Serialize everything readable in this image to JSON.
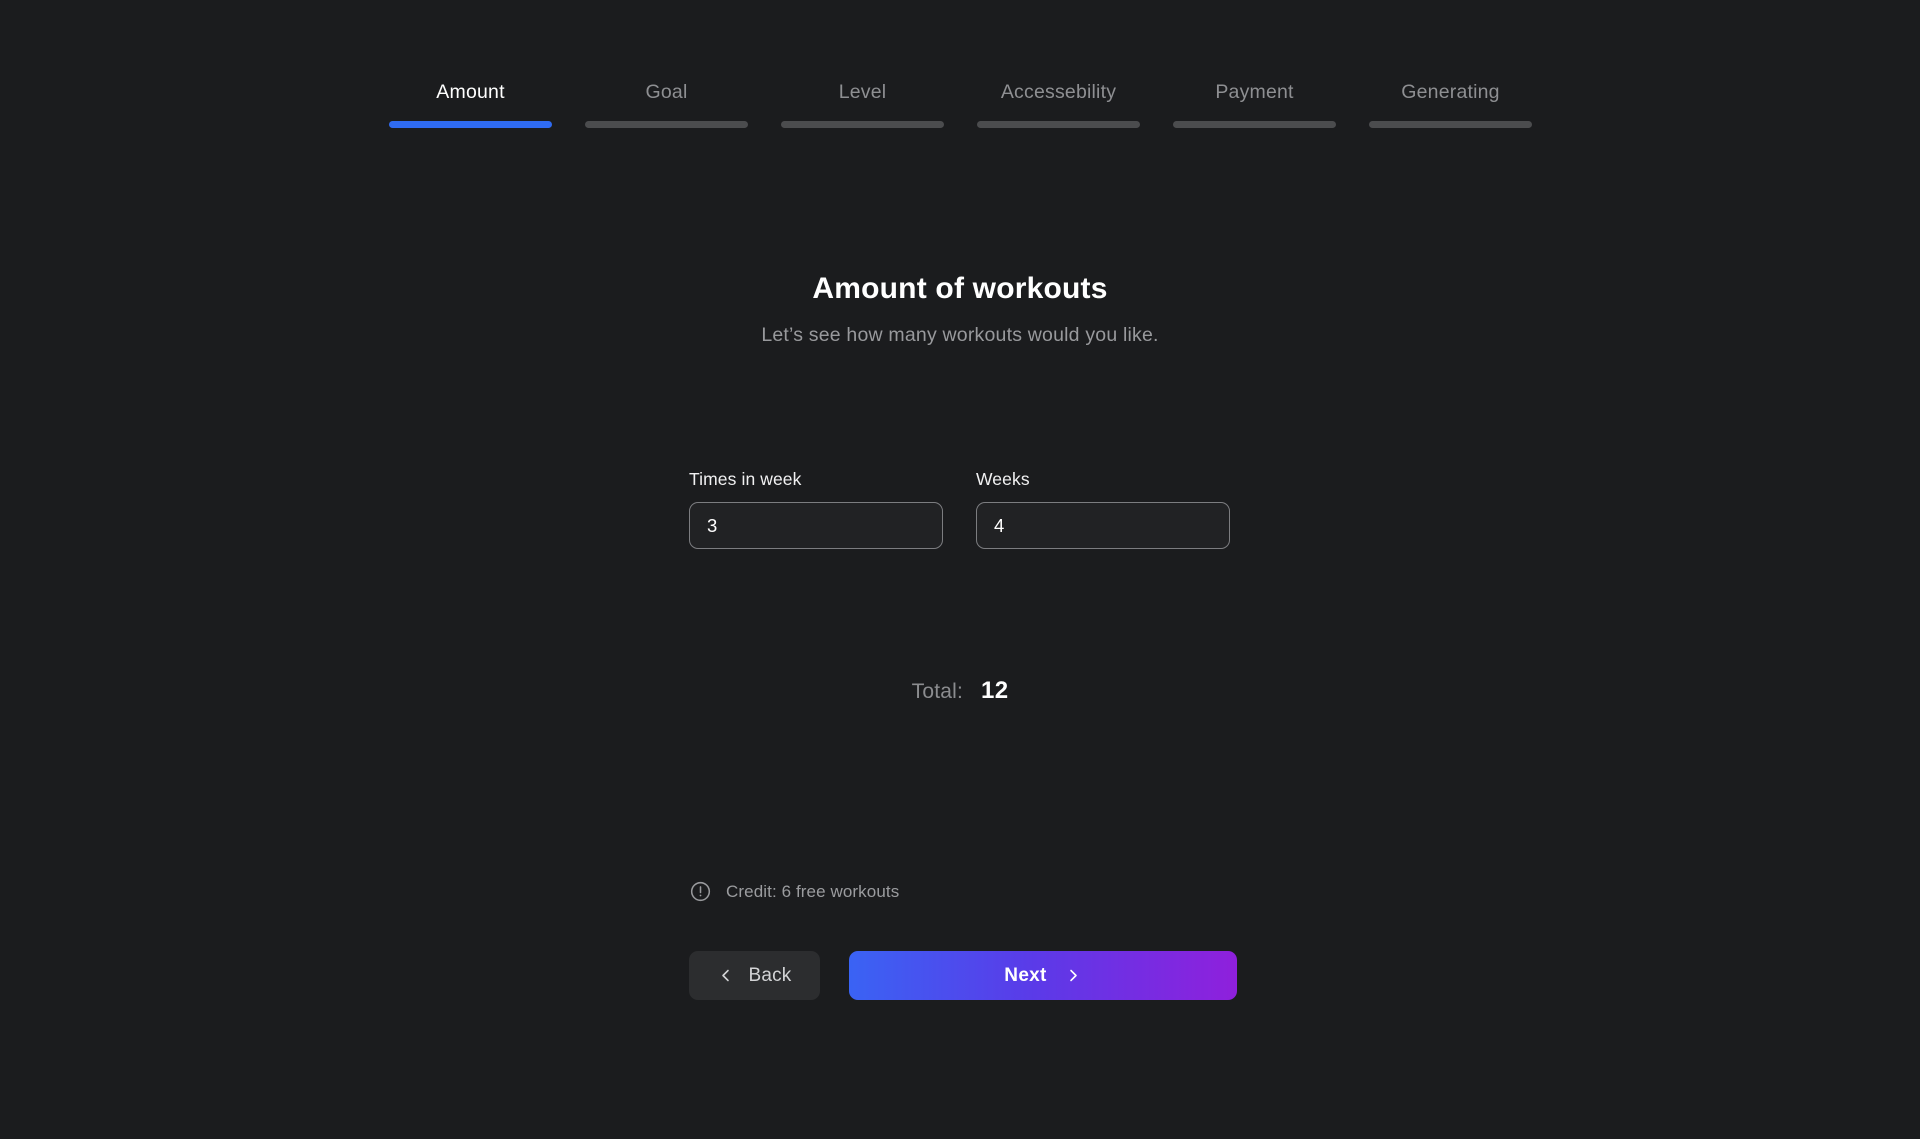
{
  "theme": {
    "background": "#1b1c1e",
    "accent_blue": "#2f6bf2",
    "gradient_start": "#3a63f4",
    "gradient_mid": "#5b3ae8",
    "gradient_end": "#8f20dc",
    "inactive_bar": "#4b4c4e",
    "muted_text": "#8e8f92"
  },
  "stepper": {
    "active_index": 0,
    "steps": [
      {
        "label": "Amount",
        "active": true
      },
      {
        "label": "Goal",
        "active": false
      },
      {
        "label": "Level",
        "active": false
      },
      {
        "label": "Accessebility",
        "active": false
      },
      {
        "label": "Payment",
        "active": false
      },
      {
        "label": "Generating",
        "active": false
      }
    ]
  },
  "main": {
    "title": "Amount of workouts",
    "subtitle": "Let’s see how many workouts would you like.",
    "fields": [
      {
        "label": "Times in week",
        "value": "3",
        "placeholder": "Times in week"
      },
      {
        "label": "Weeks",
        "value": "4",
        "placeholder": "Weeks"
      }
    ],
    "total": {
      "label": "Total:",
      "value": "12"
    },
    "credit": {
      "icon": "exclamation-circle-icon",
      "text": "Credit: 6 free workouts"
    }
  },
  "actions": {
    "back": {
      "label": "Back",
      "icon": "chevron-left-icon"
    },
    "next": {
      "label": "Next",
      "icon": "chevron-right-icon"
    }
  }
}
